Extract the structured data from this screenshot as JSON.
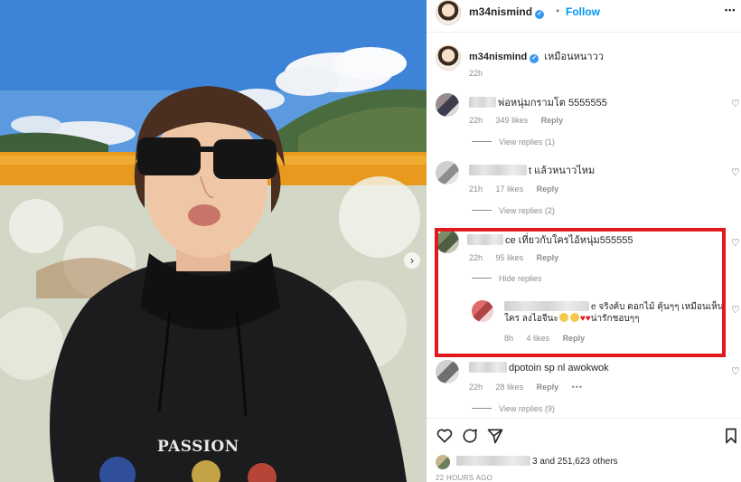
{
  "post_header": {
    "username": "m34nismind",
    "separator": "•",
    "follow_label": "Follow",
    "more_label": "•••"
  },
  "caption": {
    "username": "m34nismind",
    "text": "เหมือนหนาวว",
    "time": "22h"
  },
  "comments": [
    {
      "text": "พ่อหนุ่มกรามโต 5555555",
      "time": "22h",
      "likes": "349 likes",
      "reply": "Reply",
      "view_replies": "View replies (1)"
    },
    {
      "text": "t แล้วหนาวไหม",
      "time": "21h",
      "likes": "17 likes",
      "reply": "Reply",
      "view_replies": "View replies (2)"
    },
    {
      "text": "ce เที่ยวกับใครไอ้หนุ่ม555555",
      "time": "22h",
      "likes": "95 likes",
      "reply": "Reply",
      "hide_replies": "Hide replies",
      "reply_item": {
        "text_line1": "e จริงค้บ ดอกไม้ คุ้นๆๆ เหมือนเห็น",
        "text_line2_a": "ใคร ลงไอจีนะ",
        "text_line2_b": "น่ารักชอบๆๆ",
        "time": "8h",
        "likes": "4 likes",
        "reply": "Reply"
      }
    },
    {
      "text": "dpotoin sp nl awokwok",
      "time": "22h",
      "likes": "28 likes",
      "reply": "Reply",
      "more": "•••",
      "view_replies": "View replies (9)"
    }
  ],
  "engagement": {
    "likes_text": "3 and 251,623 others",
    "timestamp": "22 HOURS AGO"
  },
  "photo": {
    "print_text": "PASSION"
  },
  "colors": {
    "accent": "#0095f6",
    "highlight": "#e0191d",
    "verified": "#3897f0"
  },
  "icons": [
    "heart-icon",
    "comment-icon",
    "share-icon",
    "bookmark-icon",
    "verified-icon",
    "chevron-right-icon"
  ]
}
